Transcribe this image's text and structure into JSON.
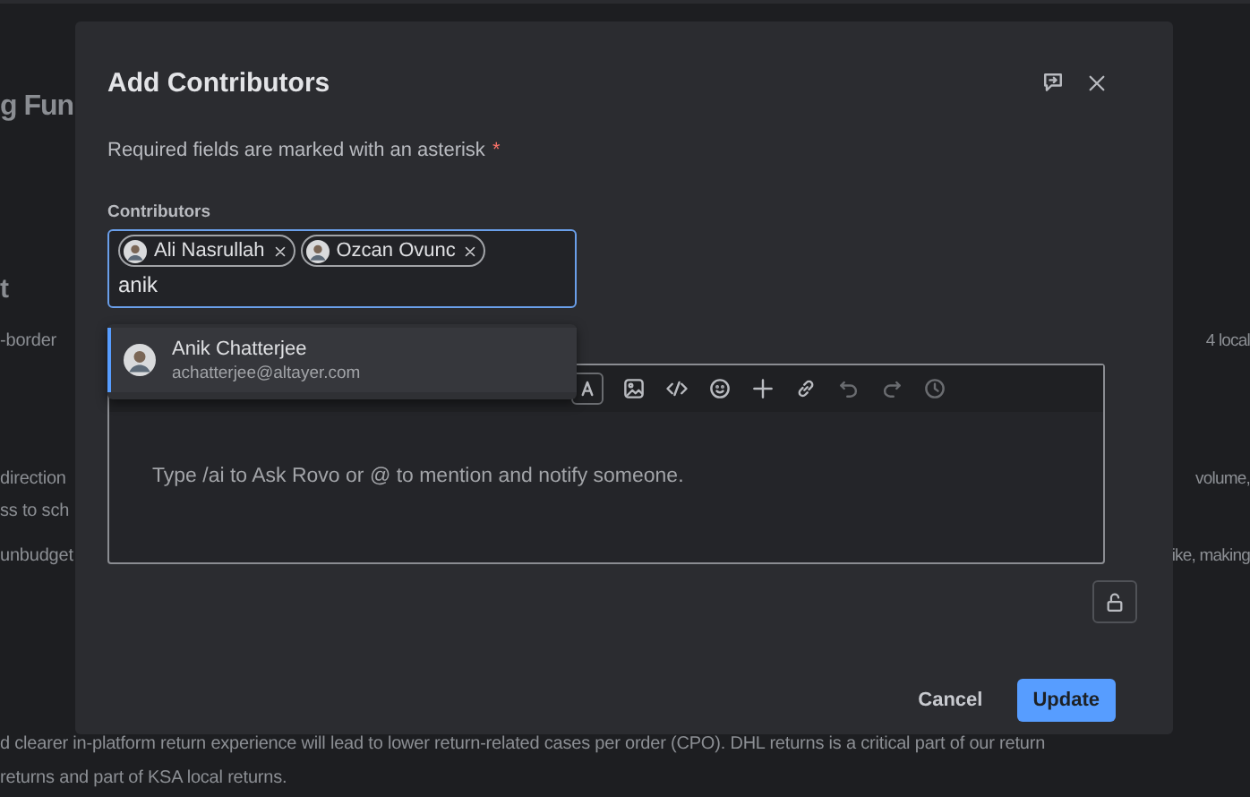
{
  "background_page": {
    "heading": "g Fun",
    "subheading": "t",
    "lines": [
      {
        "left": "-border",
        "right": "4 local"
      },
      {
        "left": "direction",
        "right": "volume,"
      },
      {
        "left": "ss to sch"
      },
      {
        "left": "unbudget",
        "right": "ike, making"
      },
      {
        "left": "d clearer in-platform return experience will lead to lower return-related cases per order (CPO). DHL returns is a critical part of our return"
      },
      {
        "left": "returns and part of KSA local returns."
      }
    ]
  },
  "dialog": {
    "title": "Add Contributors",
    "required_note": "Required fields are marked with an asterisk",
    "required_mark": "*",
    "contributors": {
      "label": "Contributors",
      "chips": [
        {
          "name": "Ali Nasrullah"
        },
        {
          "name": "Ozcan Ovunc"
        }
      ],
      "value": "anik"
    },
    "suggestions": [
      {
        "name": "Anik Chatterjee",
        "email": "achatterjee@altayer.com",
        "selected": true
      }
    ],
    "editor": {
      "placeholder": "Type /ai to Ask Rovo or @ to mention and notify someone."
    },
    "buttons": [
      {
        "label": "Cancel",
        "kind": "subtle"
      },
      {
        "label": "Update",
        "kind": "primary"
      }
    ]
  }
}
